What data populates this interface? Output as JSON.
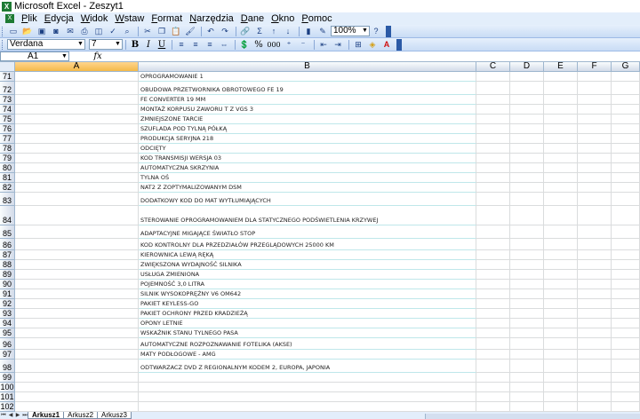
{
  "window": {
    "title": "Microsoft Excel - Zeszyt1",
    "app_icon": "excel-icon"
  },
  "menu": {
    "items": [
      "Plik",
      "Edycja",
      "Widok",
      "Wstaw",
      "Format",
      "Narzędzia",
      "Dane",
      "Okno",
      "Pomoc"
    ]
  },
  "toolbar": {
    "zoom": "100%",
    "icons": [
      "new-icon",
      "open-icon",
      "save-icon",
      "permission-icon",
      "email-icon",
      "print-icon",
      "print-preview-icon",
      "spelling-icon",
      "research-icon",
      "cut-icon",
      "copy-icon",
      "paste-icon",
      "format-painter-icon",
      "undo-icon",
      "redo-icon",
      "hyperlink-icon",
      "autosum-icon",
      "sort-ascending-icon",
      "sort-descending-icon",
      "chart-wizard-icon",
      "drawing-icon",
      "help-icon"
    ]
  },
  "format_toolbar": {
    "font": "Verdana",
    "size": "7",
    "bold": "B",
    "italic": "I",
    "underline": "U",
    "currency": "%",
    "comma": "000"
  },
  "formula_bar": {
    "name_box": "A1",
    "fx": "fx",
    "value": ""
  },
  "columns": [
    "A",
    "B",
    "C",
    "D",
    "E",
    "F",
    "G"
  ],
  "rows": [
    {
      "n": "71",
      "b": "OPROGRAMOWANIE 1"
    },
    {
      "n": "72",
      "b": "OBUDOWA PRZETWORNIKA OBROTOWEGO FE 19"
    },
    {
      "n": "73",
      "b": "FE CONVERTER 19 MM"
    },
    {
      "n": "74",
      "b": "MONTAŻ KORPUSU ZAWORU T Z VGS 3"
    },
    {
      "n": "75",
      "b": "ZMNIEJSZONE TARCIE"
    },
    {
      "n": "76",
      "b": "SZUFLADA POD TYLNĄ PÓŁKĄ"
    },
    {
      "n": "77",
      "b": "PRODUKCJA SERYJNA 218"
    },
    {
      "n": "78",
      "b": "ODCIĘTY"
    },
    {
      "n": "79",
      "b": "KOD TRANSMISJI WERSJA 03"
    },
    {
      "n": "80",
      "b": "AUTOMATYCZNA SKRZYNIA"
    },
    {
      "n": "81",
      "b": "TYLNA OŚ"
    },
    {
      "n": "82",
      "b": "NAT2 Z ZOPTYMALIZOWANYM DSM"
    },
    {
      "n": "83",
      "b": "DODATKOWY KOD DO MAT WYTŁUMIAJĄCYCH"
    },
    {
      "n": "84",
      "b": "STEROWANIE OPROGRAMOWANIEM DLA STATYCZNEGO PODŚWIETLENIA KRZYWEJ"
    },
    {
      "n": "85",
      "b": "ADAPTACYJNE MIGAJĄCE ŚWIATŁO STOP"
    },
    {
      "n": "86",
      "b": "KOD KONTROLNY DLA PRZEDZIAŁÓW PRZEGLĄDOWYCH 25000 KM"
    },
    {
      "n": "87",
      "b": "KIEROWNICA LEWĄ RĘKĄ"
    },
    {
      "n": "88",
      "b": "ZWIĘKSZONA WYDAJNOŚĆ SILNIKA"
    },
    {
      "n": "89",
      "b": "USŁUGA ZMIENIONA"
    },
    {
      "n": "90",
      "b": "POJEMNOŚĆ 3,0 LITRA"
    },
    {
      "n": "91",
      "b": "SILNIK WYSOKOPRĘŻNY V6 OM642"
    },
    {
      "n": "92",
      "b": "PAKIET KEYLESS-GO"
    },
    {
      "n": "93",
      "b": "PAKIET OCHRONY PRZED KRADZIEŻĄ"
    },
    {
      "n": "94",
      "b": "OPONY LETNIE"
    },
    {
      "n": "95",
      "b": "WSKAŹNIK STANU TYLNEGO PASA"
    },
    {
      "n": "96",
      "b": "AUTOMATYCZNE ROZPOZNAWANIE FOTELIKA (AKSE)"
    },
    {
      "n": "97",
      "b": "MATY PODŁOGOWE - AMG"
    },
    {
      "n": "98",
      "b": "ODTWARZACZ DVD Z REGIONALNYM KODEM 2, EUROPA, JAPONIA"
    },
    {
      "n": "99",
      "b": ""
    },
    {
      "n": "100",
      "b": ""
    },
    {
      "n": "101",
      "b": ""
    },
    {
      "n": "102",
      "b": ""
    }
  ],
  "sheets": [
    "Arkusz1",
    "Arkusz2",
    "Arkusz3"
  ],
  "colors": {
    "menubar": "#e3eefb",
    "header": "#d3dbe9",
    "selected_header": "#f4b949",
    "row_border": "#bfe7ea"
  }
}
